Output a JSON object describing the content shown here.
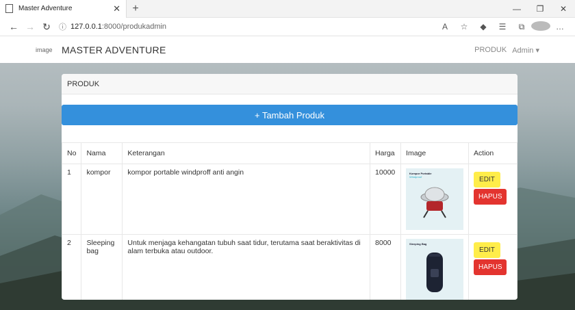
{
  "browser": {
    "tab_title": "Master Adventure",
    "url_host": "127.0.0.1",
    "url_path": ":8000/produkadmin"
  },
  "navbar": {
    "brand_img_alt": "image",
    "brand": "MASTER ADVENTURE",
    "menu_produk": "PRODUK",
    "menu_admin": "Admin"
  },
  "card": {
    "header": "PRODUK",
    "add_button": "+ Tambah Produk"
  },
  "table": {
    "headers": [
      "No",
      "Nama",
      "Keterangan",
      "Harga",
      "Image",
      "Action"
    ],
    "rows": [
      {
        "no": "1",
        "nama": "kompor",
        "keterangan": "kompor portable windproff anti angin",
        "harga": "10000",
        "image_title": "Kompor Portable",
        "image_sub": "Windproof",
        "edit": "EDIT",
        "hapus": "HAPUS"
      },
      {
        "no": "2",
        "nama": "Sleeping bag",
        "keterangan": "Untuk menjaga kehangatan tubuh saat tidur, terutama saat beraktivitas di alam terbuka atau outdoor.",
        "harga": "8000",
        "image_title": "Sleeping Bag",
        "image_sub": "",
        "edit": "EDIT",
        "hapus": "HAPUS"
      }
    ]
  },
  "colors": {
    "primary": "#3490dc",
    "edit": "#ffed4a",
    "hapus": "#e3342f"
  }
}
